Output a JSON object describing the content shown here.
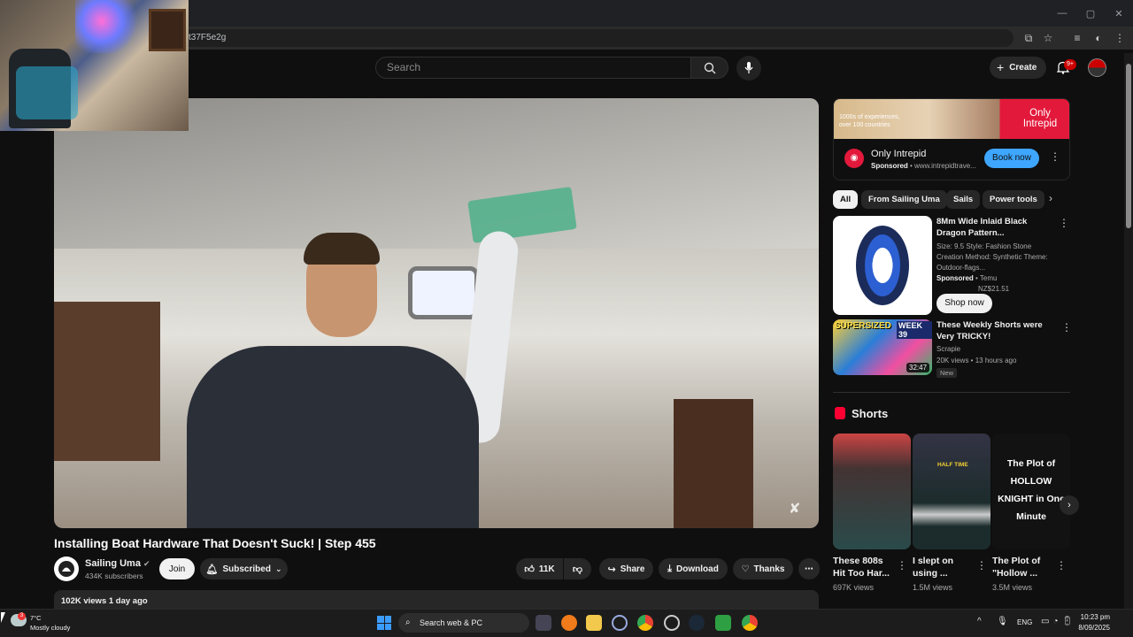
{
  "browser": {
    "url": "t37F5e2g",
    "win_min": "—",
    "win_max": "▢",
    "win_close": "✕"
  },
  "header": {
    "search_placeholder": "Search",
    "create_label": "Create",
    "notif_count": "9+"
  },
  "video": {
    "title": "Installing Boat Hardware That Doesn't Suck! | Step 455",
    "channel": "Sailing Uma",
    "subscribers": "434K subscribers",
    "join_label": "Join",
    "subscribed_label": "Subscribed",
    "likes": "11K",
    "share_label": "Share",
    "download_label": "Download",
    "thanks_label": "Thanks",
    "views_date": "102K views  1 day ago"
  },
  "ad": {
    "banner_text": "1000s of experiences, over 100 countries",
    "brand_text": "Only Intrepid",
    "title": "Only Intrepid",
    "sponsored": "Sponsored",
    "domain": "www.intrepidtrave...",
    "cta": "Book now"
  },
  "chips": [
    "All",
    "From Sailing Uma",
    "Sails",
    "Power tools"
  ],
  "recommendations": [
    {
      "title": "8Mm Wide Inlaid Black Dragon Pattern...",
      "meta": "Size: 9.5 Style: Fashion Stone Creation Method: Synthetic Theme: Outdoor-flags...",
      "sponsored": "Sponsored",
      "seller": "Temu",
      "price": "NZ$21.51",
      "cta": "Shop now"
    },
    {
      "title": "These Weekly Shorts were Very TRICKY!",
      "channel": "Scrapie",
      "meta": "20K views • 13 hours ago",
      "badge": "New",
      "duration": "32:47",
      "thumb_text_1": "SUPERSIZED",
      "thumb_text_2": "WEEK 39"
    }
  ],
  "shorts": {
    "title": "Shorts",
    "items": [
      {
        "title": "These 808s Hit Too Har...",
        "views": "697K views"
      },
      {
        "title": "I slept on using ...",
        "views": "1.5M views",
        "thumb_text": "HALF TIME"
      },
      {
        "title": "The Plot of \"Hollow ...",
        "views": "3.5M views",
        "thumb_text": "The Plot of HOLLOW KNIGHT in One Minute"
      }
    ]
  },
  "taskbar": {
    "temp": "7°C",
    "condition": "Mostly cloudy",
    "weather_badge": "3",
    "search_label": "Search web & PC",
    "lang": "ENG",
    "time": "10:23 pm",
    "date": "8/09/2025"
  },
  "colors": {
    "accent_blue": "#3ea6ff",
    "brand_red": "#ff0033",
    "ad_red": "#e3193b"
  }
}
